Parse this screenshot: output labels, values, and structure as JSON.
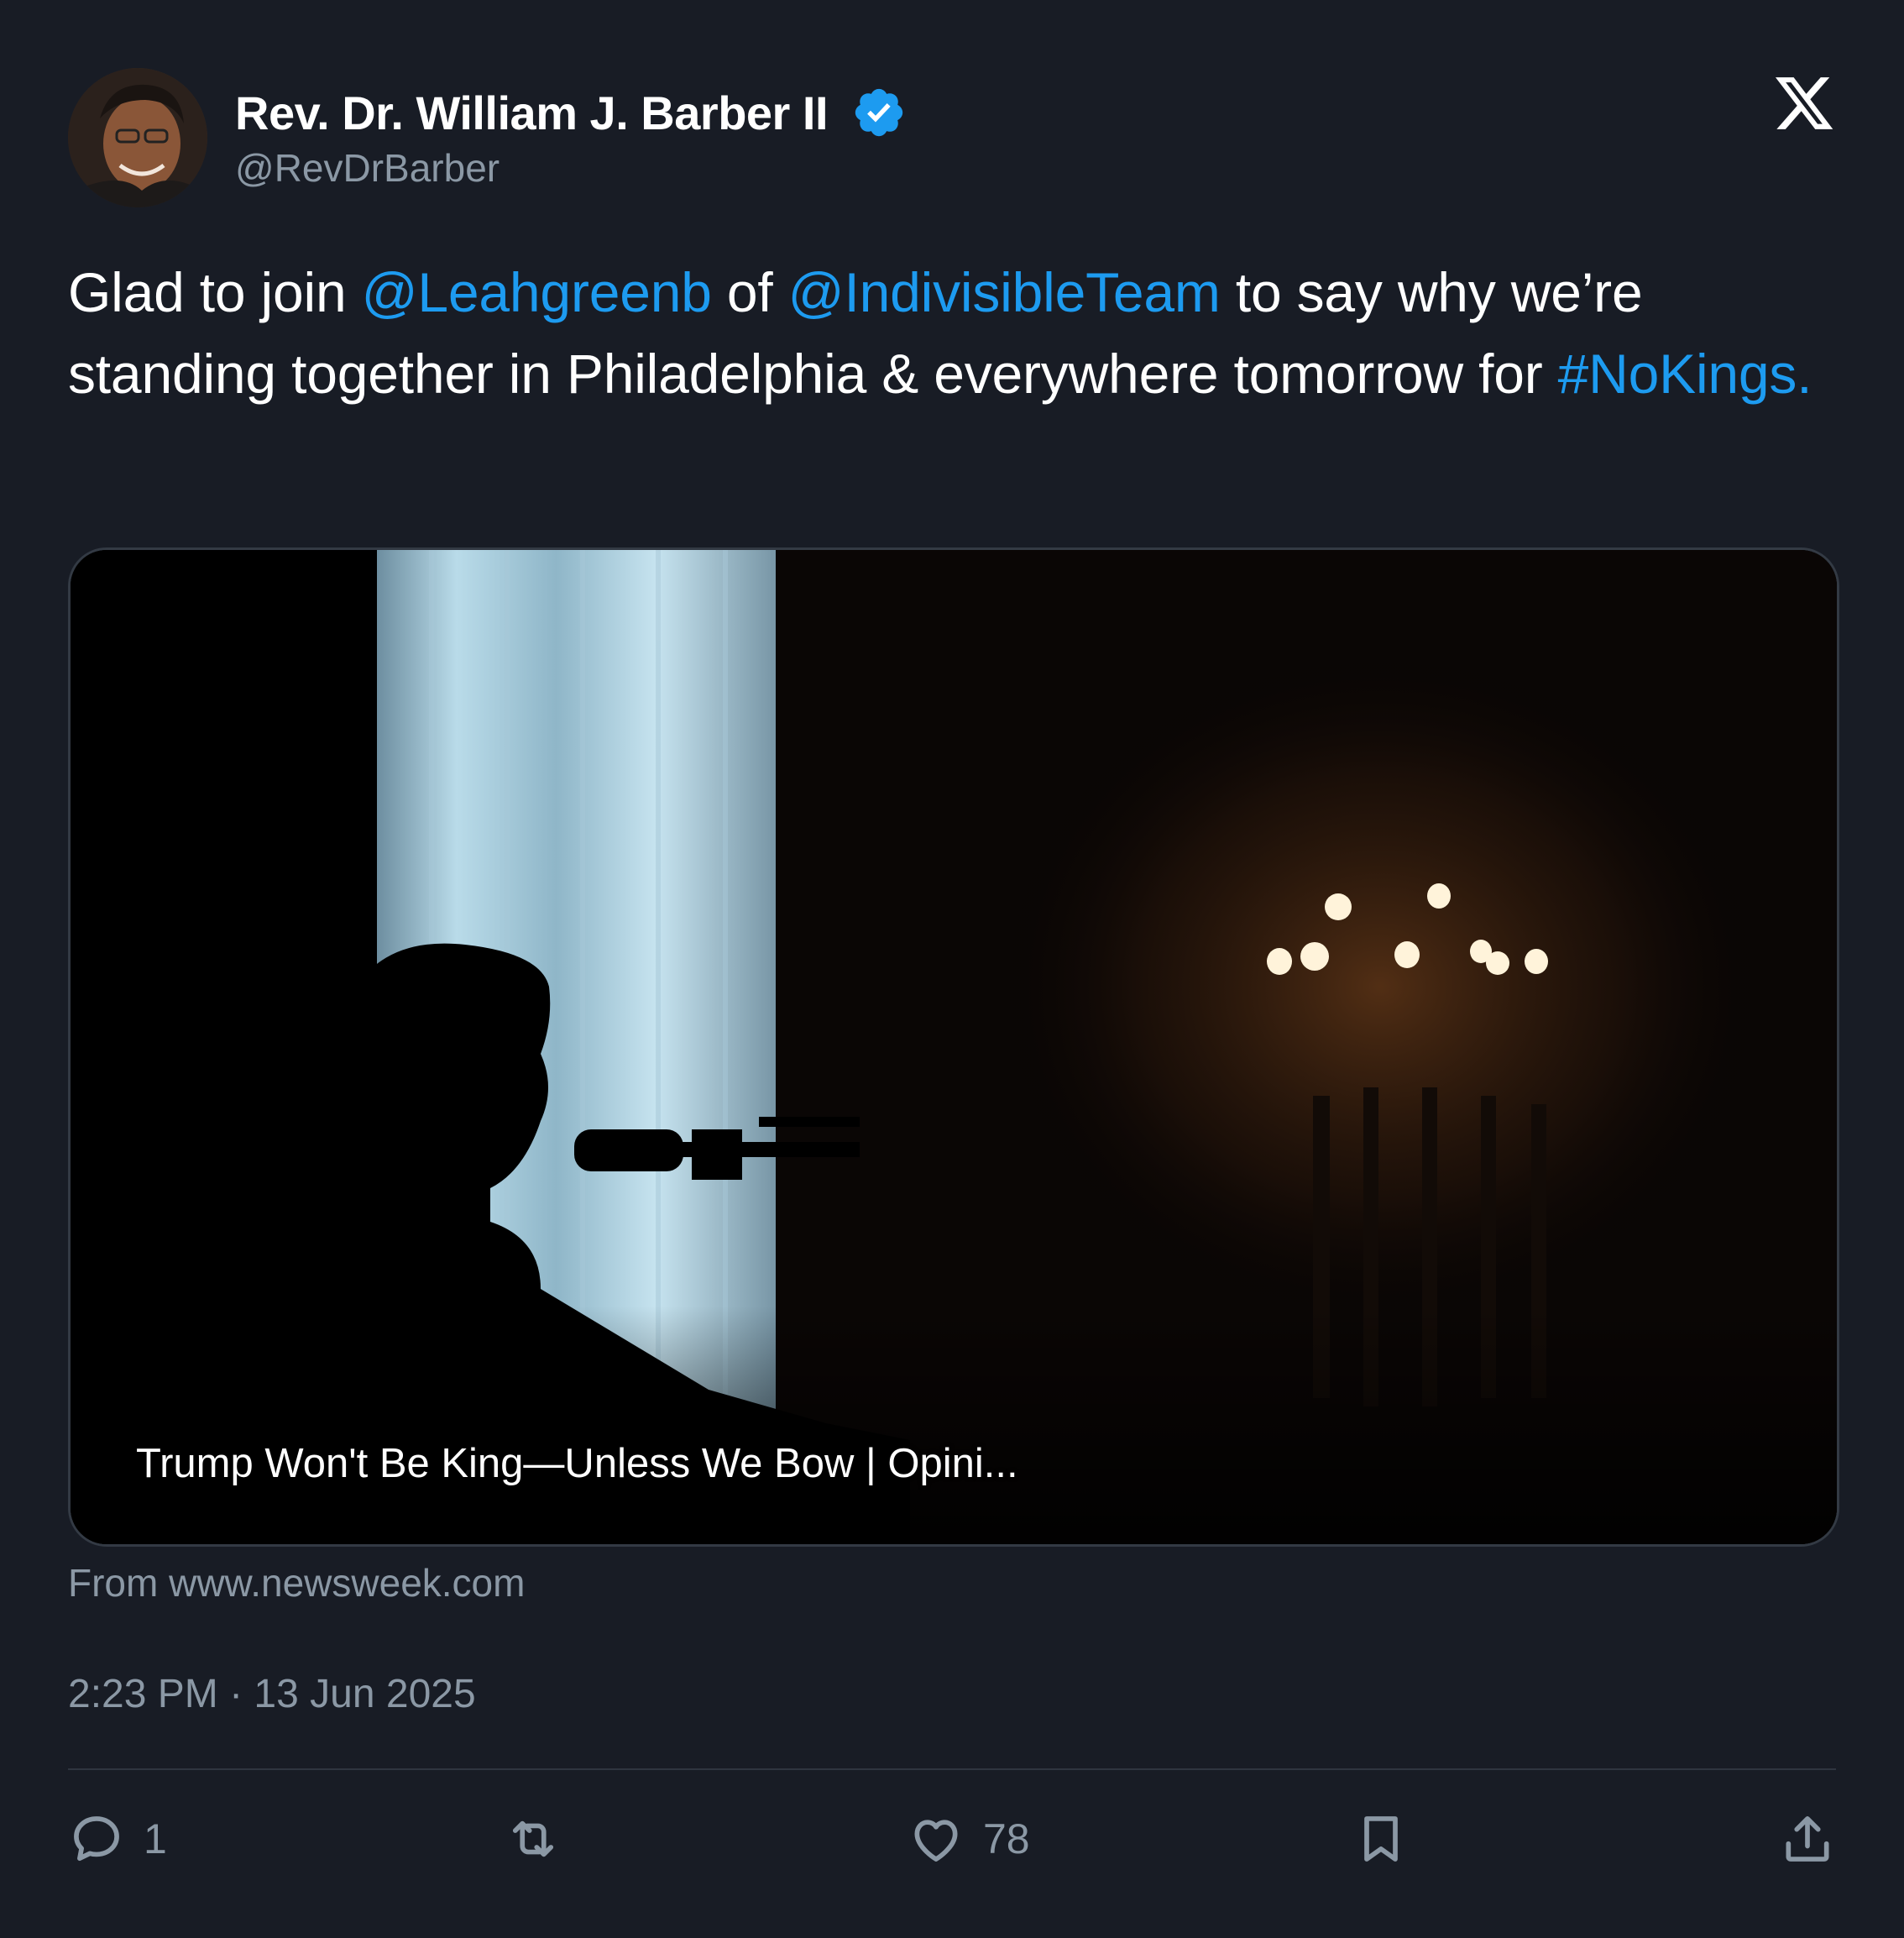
{
  "author": {
    "display_name": "Rev. Dr. William J. Barber II",
    "handle": "@RevDrBarber",
    "verified": true
  },
  "tweet": {
    "text_parts": [
      {
        "text": "Glad to join ",
        "type": "text"
      },
      {
        "text": "@Leahgreenb",
        "type": "mention"
      },
      {
        "text": " of ",
        "type": "text"
      },
      {
        "text": "@IndivisibleTeam",
        "type": "mention"
      },
      {
        "text": " to say why we’re standing together in Philadelphia & everywhere tomorrow for ",
        "type": "text"
      },
      {
        "text": "#NoKings.",
        "type": "hashtag"
      }
    ]
  },
  "card": {
    "title": "Trump Won't Be King—Unless We Bow | Opini...",
    "source": "From www.newsweek.com"
  },
  "timestamp": "2:23 PM · 13 Jun 2025",
  "actions": {
    "reply_count": "1",
    "retweet_count": "",
    "like_count": "78"
  },
  "icons": {
    "brand": "x-logo-icon",
    "verified": "verified-badge-icon",
    "reply": "reply-icon",
    "retweet": "retweet-icon",
    "like": "heart-icon",
    "bookmark": "bookmark-icon",
    "share": "share-icon"
  },
  "colors": {
    "background": "#181c25",
    "link": "#1d9bf0",
    "muted": "#8b98a5",
    "verified": "#1d9bf0"
  }
}
